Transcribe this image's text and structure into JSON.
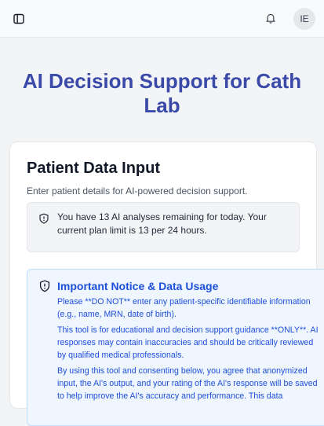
{
  "header": {
    "avatar_initials": "IE",
    "icons": [
      "sidebar-toggle-icon",
      "bell-icon"
    ]
  },
  "page": {
    "title": "AI Decision Support for Cath Lab"
  },
  "form_card": {
    "title": "Patient Data Input",
    "subtitle": "Enter patient details for AI-powered decision support."
  },
  "usage_limit": {
    "message": "You have 13 AI analyses remaining for today. Your current plan limit is 13 per 24 hours."
  },
  "notice": {
    "title": "Important Notice & Data Usage",
    "paragraphs": [
      "Please **DO NOT** enter any patient-specific identifiable information (e.g., name, MRN, date of birth).",
      "This tool is for educational and decision support guidance **ONLY**. AI responses may contain inaccuracies and should be critically reviewed by qualified medical professionals.",
      "By using this tool and consenting below, you agree that anonymized input, the AI's output, and your rating of the AI's response will be saved to help improve the AI's accuracy and performance. This data"
    ]
  },
  "colors": {
    "title_accent": "#3b4aa8",
    "notice_text": "#1d4ed8",
    "notice_bg": "#eff6ff"
  }
}
